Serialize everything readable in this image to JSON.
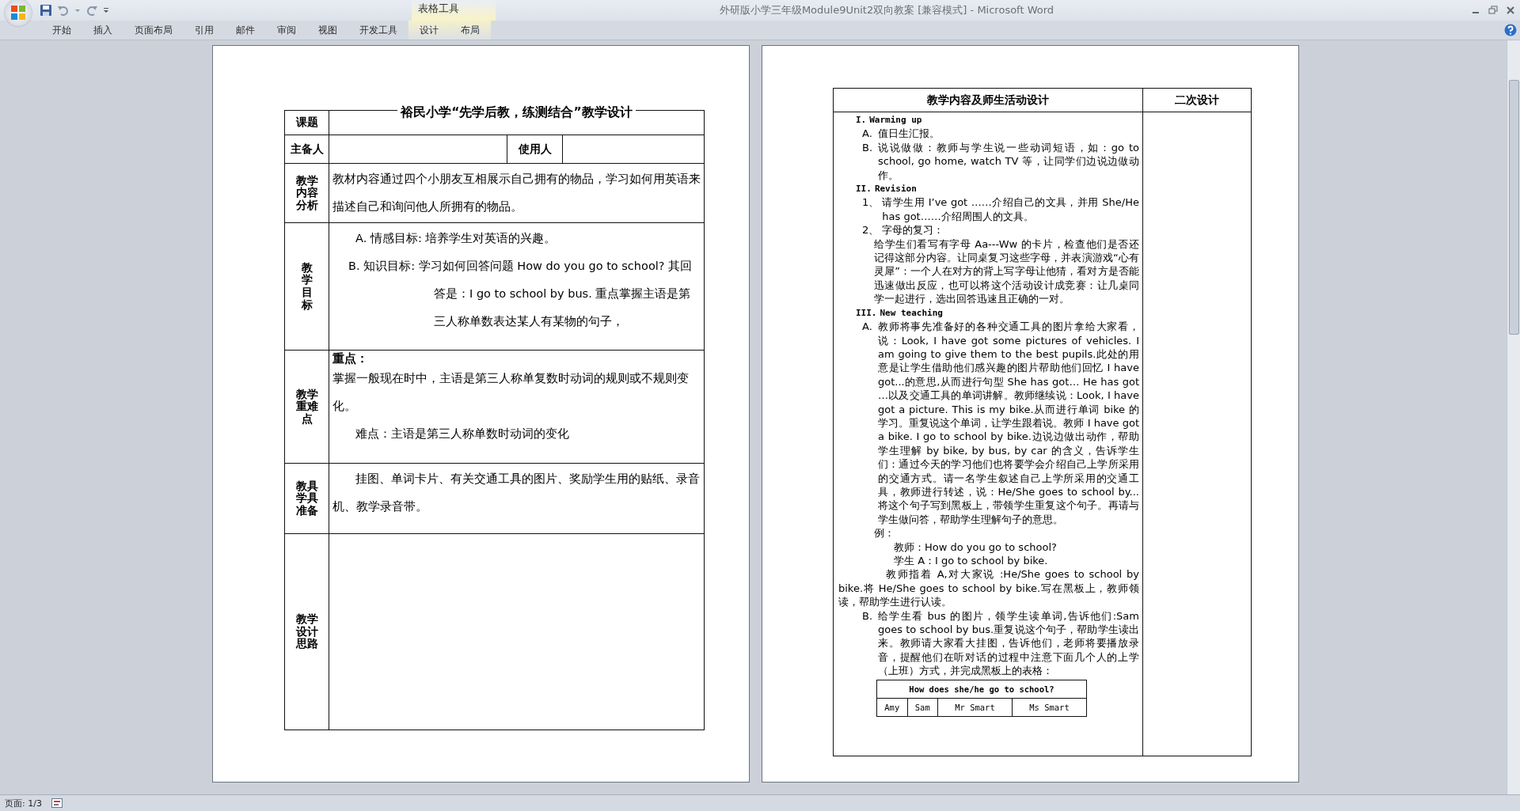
{
  "window": {
    "title": "外研版小学三年级Module9Unit2双向教案 [兼容模式] - Microsoft Word"
  },
  "ribbon": {
    "contextual_group": "表格工具",
    "tabs": [
      {
        "label": "开始",
        "selected": false,
        "contextual": false
      },
      {
        "label": "插入",
        "selected": false,
        "contextual": false
      },
      {
        "label": "页面布局",
        "selected": false,
        "contextual": false
      },
      {
        "label": "引用",
        "selected": false,
        "contextual": false
      },
      {
        "label": "邮件",
        "selected": false,
        "contextual": false
      },
      {
        "label": "审阅",
        "selected": false,
        "contextual": false
      },
      {
        "label": "视图",
        "selected": false,
        "contextual": false
      },
      {
        "label": "开发工具",
        "selected": false,
        "contextual": false
      },
      {
        "label": "设计",
        "selected": false,
        "contextual": true
      },
      {
        "label": "布局",
        "selected": false,
        "contextual": true
      }
    ]
  },
  "left_page": {
    "title_label": "课题",
    "title": "裕民小学“先学后教，练测结合”教学设计",
    "preparer_label": "主备人",
    "user_label": "使用人",
    "sections": [
      {
        "label_lines": [
          "教学",
          "内容",
          "分析"
        ],
        "paragraphs": [
          {
            "kind": "plain",
            "text": "教材内容通过四个小朋友互相展示自己拥有的物品，学习如何用英语来描述自己和询问他人所拥有的物品。"
          }
        ]
      },
      {
        "label_lines": [
          "教",
          "学",
          "目",
          "标"
        ],
        "paragraphs": [
          {
            "kind": "indent",
            "text": "A. 情感目标: 培养学生对英语的兴趣。"
          },
          {
            "kind": "hanging",
            "text": "B. 知识目标: 学习如何回答问题 How do you go to school? 其回答是：I go to school by bus. 重点掌握主语是第三人称单数表达某人有某物的句子，"
          }
        ]
      },
      {
        "label_lines": [
          "教学",
          "重难",
          "点"
        ],
        "paragraphs": [
          {
            "kind": "heading",
            "text": "重点："
          },
          {
            "kind": "plain",
            "text": "  掌握一般现在时中，主语是第三人称单复数时动词的规则或不规则变化。"
          },
          {
            "kind": "indent",
            "text": "难点：主语是第三人称单数时动词的变化"
          }
        ]
      },
      {
        "label_lines": [
          "教具",
          "学具",
          "准备"
        ],
        "paragraphs": [
          {
            "kind": "indent",
            "text": "挂图、单词卡片、有关交通工具的图片、奖励学生用的贴纸、录音机、教学录音带。"
          }
        ]
      },
      {
        "label_lines": [
          "教学",
          "设计",
          "思路"
        ]
      }
    ]
  },
  "right_page": {
    "columns": [
      "教学内容及师生活动设计",
      "二次设计"
    ],
    "blocks": [
      {
        "kind": "heading",
        "marker": "I.",
        "text": "Warming up"
      },
      {
        "kind": "item",
        "marker": "A.",
        "text": "值日生汇报。"
      },
      {
        "kind": "item",
        "marker": "B.",
        "text": "说说做做：教师与学生说一些动词短语，如：go to school, go home, watch TV 等，让同学们边说边做动作。"
      },
      {
        "kind": "heading",
        "marker": "II.",
        "text": "Revision"
      },
      {
        "kind": "item",
        "marker": "1、",
        "text": "请学生用 I’ve got ……介绍自己的文具，并用 She/He has got……介绍周围人的文具。"
      },
      {
        "kind": "item",
        "marker": "2、",
        "text": "字母的复习："
      },
      {
        "kind": "para",
        "text": "给学生们看写有字母 Aa---Ww 的卡片，检查他们是否还记得这部分内容。让同桌复习这些字母，并表演游戏“心有灵犀”：一个人在对方的背上写字母让他猜，看对方是否能迅速做出反应，也可以将这个活动设计成竞赛：让几桌同学一起进行，选出回答迅速且正确的一对。"
      },
      {
        "kind": "heading",
        "marker": "III.",
        "text": "New teaching"
      },
      {
        "kind": "item",
        "marker": "A.",
        "text": "教师将事先准备好的各种交通工具的图片拿给大家看，说：Look, I have got some pictures of vehicles. I am going to give them to the best pupils.此处的用意是让学生借助他们感兴趣的图片帮助他们回忆 I have got...的意思,从而进行句型 She has got… He has got …以及交通工具的单词讲解。教师继续说：Look, I have got a picture. This is my bike.从而进行单词 bike 的学习。重复说这个单词，让学生跟着说。教师 I have got a bike. I go to school by bike.边说边做出动作，帮助学生理解 by bike, by bus, by car 的含义，告诉学生们：通过今天的学习他们也将要学会介绍自己上学所采用的交通方式。请一名学生叙述自己上学所采用的交通工具，教师进行转述，说：He/She goes to school by...将这个句子写到黑板上，带领学生重复这个句子。再请与学生做问答，帮助学生理解句子的意思。"
      },
      {
        "kind": "para",
        "text": "例："
      },
      {
        "kind": "example",
        "text": "教师：How do you go to school?"
      },
      {
        "kind": "example",
        "text": "学生 A：I go to school by bike."
      },
      {
        "kind": "note",
        "text": "教师指着 A,对大家说 :He/She goes to school by bike.将 He/She goes to school by bike.写在黑板上，教师领读，帮助学生进行认读。"
      },
      {
        "kind": "item",
        "marker": "B.",
        "text": "给学生看 bus 的图片，领学生读单词,告诉他们:Sam goes to school by bus.重复说这个句子，帮助学生读出来。教师请大家看大挂图，告诉他们，老师将要播放录音，提醒他们在听对话的过程中注意下面几个人的上学（上班）方式，并完成黑板上的表格："
      }
    ],
    "inner_table": {
      "title": "How does she/he go to school?",
      "columns": [
        "Amy",
        "Sam",
        "Mr Smart",
        "Ms Smart"
      ]
    }
  },
  "status_bar": {
    "page": "页面: 1/3"
  }
}
